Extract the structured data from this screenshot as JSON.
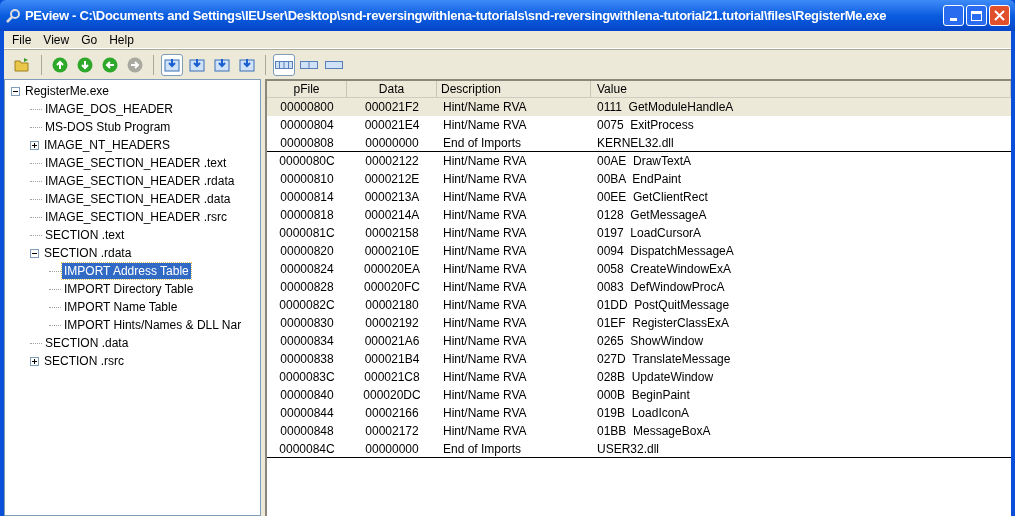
{
  "window": {
    "title": "PEview - C:\\Documents and Settings\\IEUser\\Desktop\\snd-reversingwithlena-tutorials\\snd-reversingwithlena-tutorial21.tutorial\\files\\RegisterMe.exe"
  },
  "menu": [
    "File",
    "View",
    "Go",
    "Help"
  ],
  "toolbar": [
    {
      "kind": "open",
      "selected": false
    },
    {
      "kind": "sep"
    },
    {
      "kind": "up",
      "selected": false,
      "disabled": false
    },
    {
      "kind": "down",
      "selected": false,
      "disabled": false
    },
    {
      "kind": "back",
      "selected": false,
      "disabled": false
    },
    {
      "kind": "forward",
      "selected": false,
      "disabled": true
    },
    {
      "kind": "sep"
    },
    {
      "kind": "view1",
      "selected": true
    },
    {
      "kind": "view2",
      "selected": false
    },
    {
      "kind": "view3",
      "selected": false
    },
    {
      "kind": "view4",
      "selected": false
    },
    {
      "kind": "sep"
    },
    {
      "kind": "layout1",
      "selected": true
    },
    {
      "kind": "layout2",
      "selected": false
    },
    {
      "kind": "layout3",
      "selected": false
    }
  ],
  "tree": [
    {
      "label": "RegisterMe.exe",
      "selected": false,
      "expanded": true,
      "children": [
        {
          "label": "IMAGE_DOS_HEADER",
          "selected": false
        },
        {
          "label": "MS-DOS Stub Program",
          "selected": false
        },
        {
          "label": "IMAGE_NT_HEADERS",
          "selected": false,
          "expanded": false
        },
        {
          "label": "IMAGE_SECTION_HEADER .text",
          "selected": false
        },
        {
          "label": "IMAGE_SECTION_HEADER .rdata",
          "selected": false
        },
        {
          "label": "IMAGE_SECTION_HEADER .data",
          "selected": false
        },
        {
          "label": "IMAGE_SECTION_HEADER .rsrc",
          "selected": false
        },
        {
          "label": "SECTION .text",
          "selected": false
        },
        {
          "label": "SECTION .rdata",
          "selected": false,
          "expanded": true,
          "children": [
            {
              "label": "IMPORT Address Table",
              "selected": true
            },
            {
              "label": "IMPORT Directory Table",
              "selected": false
            },
            {
              "label": "IMPORT Name Table",
              "selected": false
            },
            {
              "label": "IMPORT Hints/Names & DLL Nar",
              "selected": false
            }
          ]
        },
        {
          "label": "SECTION .data",
          "selected": false
        },
        {
          "label": "SECTION .rsrc",
          "selected": false,
          "expanded": false
        }
      ]
    }
  ],
  "table": {
    "columns": [
      "pFile",
      "Data",
      "Description",
      "Value"
    ],
    "rows": [
      {
        "kind": "entry",
        "selected": true,
        "cells": [
          "00000800",
          "000021F2",
          "Hint/Name RVA",
          "0111  GetModuleHandleA"
        ]
      },
      {
        "kind": "entry",
        "selected": false,
        "cells": [
          "00000804",
          "000021E4",
          "Hint/Name RVA",
          "0075  ExitProcess"
        ]
      },
      {
        "kind": "end",
        "selected": false,
        "cells": [
          "00000808",
          "00000000",
          "End of Imports",
          "KERNEL32.dll"
        ]
      },
      {
        "kind": "entry",
        "selected": false,
        "cells": [
          "0000080C",
          "00002122",
          "Hint/Name RVA",
          "00AE  DrawTextA"
        ]
      },
      {
        "kind": "entry",
        "selected": false,
        "cells": [
          "00000810",
          "0000212E",
          "Hint/Name RVA",
          "00BA  EndPaint"
        ]
      },
      {
        "kind": "entry",
        "selected": false,
        "cells": [
          "00000814",
          "0000213A",
          "Hint/Name RVA",
          "00EE  GetClientRect"
        ]
      },
      {
        "kind": "entry",
        "selected": false,
        "cells": [
          "00000818",
          "0000214A",
          "Hint/Name RVA",
          "0128  GetMessageA"
        ]
      },
      {
        "kind": "entry",
        "selected": false,
        "cells": [
          "0000081C",
          "00002158",
          "Hint/Name RVA",
          "0197  LoadCursorA"
        ]
      },
      {
        "kind": "entry",
        "selected": false,
        "cells": [
          "00000820",
          "0000210E",
          "Hint/Name RVA",
          "0094  DispatchMessageA"
        ]
      },
      {
        "kind": "entry",
        "selected": false,
        "cells": [
          "00000824",
          "000020EA",
          "Hint/Name RVA",
          "0058  CreateWindowExA"
        ]
      },
      {
        "kind": "entry",
        "selected": false,
        "cells": [
          "00000828",
          "000020FC",
          "Hint/Name RVA",
          "0083  DefWindowProcA"
        ]
      },
      {
        "kind": "entry",
        "selected": false,
        "cells": [
          "0000082C",
          "00002180",
          "Hint/Name RVA",
          "01DD  PostQuitMessage"
        ]
      },
      {
        "kind": "entry",
        "selected": false,
        "cells": [
          "00000830",
          "00002192",
          "Hint/Name RVA",
          "01EF  RegisterClassExA"
        ]
      },
      {
        "kind": "entry",
        "selected": false,
        "cells": [
          "00000834",
          "000021A6",
          "Hint/Name RVA",
          "0265  ShowWindow"
        ]
      },
      {
        "kind": "entry",
        "selected": false,
        "cells": [
          "00000838",
          "000021B4",
          "Hint/Name RVA",
          "027D  TranslateMessage"
        ]
      },
      {
        "kind": "entry",
        "selected": false,
        "cells": [
          "0000083C",
          "000021C8",
          "Hint/Name RVA",
          "028B  UpdateWindow"
        ]
      },
      {
        "kind": "entry",
        "selected": false,
        "cells": [
          "00000840",
          "000020DC",
          "Hint/Name RVA",
          "000B  BeginPaint"
        ]
      },
      {
        "kind": "entry",
        "selected": false,
        "cells": [
          "00000844",
          "00002166",
          "Hint/Name RVA",
          "019B  LoadIconA"
        ]
      },
      {
        "kind": "entry",
        "selected": false,
        "cells": [
          "00000848",
          "00002172",
          "Hint/Name RVA",
          "01BB  MessageBoxA"
        ]
      },
      {
        "kind": "end",
        "selected": false,
        "cells": [
          "0000084C",
          "00000000",
          "End of Imports",
          "USER32.dll"
        ]
      }
    ]
  }
}
